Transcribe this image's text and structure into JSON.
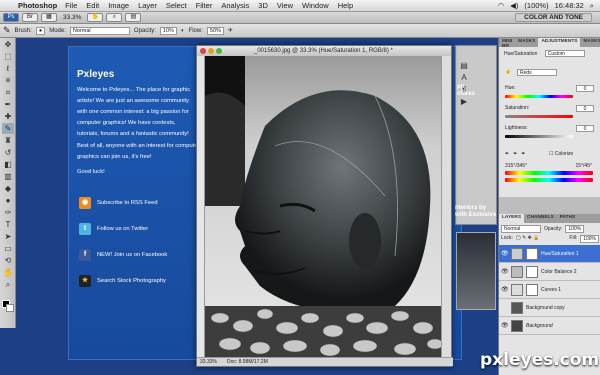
{
  "menubar": {
    "apple": "",
    "app": "Photoshop",
    "items": [
      "File",
      "Edit",
      "Image",
      "Layer",
      "Select",
      "Filter",
      "Analysis",
      "3D",
      "View",
      "Window",
      "Help"
    ],
    "battery": "(100%)",
    "time": "16:48:32"
  },
  "appbar": {
    "zoom": "33.3%",
    "workspace": "COLOR AND TONE"
  },
  "options": {
    "brush_label": "Brush:",
    "mode_label": "Mode:",
    "mode_value": "Normal",
    "opacity_label": "Opacity:",
    "opacity_value": "10%",
    "flow_label": "Flow:",
    "flow_value": "50%"
  },
  "site": {
    "title": "Pxleyes",
    "welcome": "Welcome to Pxleyes... The place for graphic artists! We are just an awesome community with one common interest: a big passion for computer graphics! We have contests, tutorials, forums and a fantastic community!",
    "best": "Best of all, anyone with an interest for computer graphics can join us, it's free!",
    "goodluck": "Good luck!",
    "links": [
      {
        "label": "Subscribe to RSS Feed"
      },
      {
        "label": "Follow us on Twitter"
      },
      {
        "label": "NEW! Join us on Facebook"
      },
      {
        "label": "Search Stock Photography"
      }
    ],
    "right1": "pp\nctures",
    "right2": "nteriors by\nwith Exclusive"
  },
  "document": {
    "title": "_0015630.jpg @ 33.3% (Hue/Saturation 1, RGB/8) *",
    "zoom": "33.33%",
    "doc_info": "Doc: 8.98M/17.2M"
  },
  "panels": {
    "top_tabs": [
      "MINI BR",
      "MASKS",
      "ADJUSTMENTS",
      "MASKS"
    ],
    "adj_title": "Hue/Saturation",
    "preset": "Custom",
    "channel": "Reds",
    "hue_label": "Hue:",
    "hue_value": "0",
    "sat_label": "Saturation:",
    "sat_value": "0",
    "light_label": "Lightness:",
    "light_value": "0",
    "colorize": "Colorize",
    "range_left": "315°/345°",
    "range_right": "15°/45°",
    "layer_tabs": [
      "LAYERS",
      "CHANNELS",
      "PATHS"
    ],
    "blend": "Normal",
    "opacity_label": "Opacity:",
    "opacity_value": "100%",
    "lock_label": "Lock:",
    "fill_label": "Fill:",
    "fill_value": "100%",
    "layers": [
      {
        "name": "Hue/Saturation 1"
      },
      {
        "name": "Color Balance 2"
      },
      {
        "name": "Curves 1"
      },
      {
        "name": "Background copy"
      },
      {
        "name": "Background"
      }
    ]
  },
  "watermark": "pxleyes.com"
}
